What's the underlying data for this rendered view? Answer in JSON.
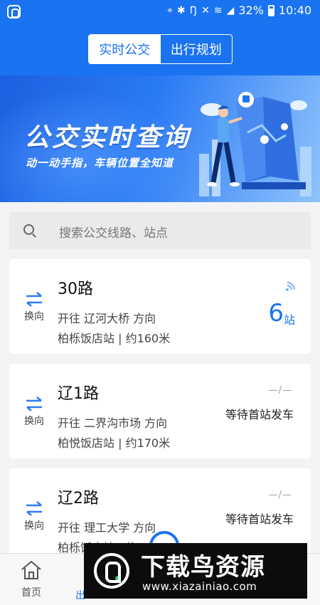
{
  "status_bar": {
    "battery": "32%",
    "time": "10:40",
    "icons": [
      "location-icon",
      "bluetooth-icon",
      "nfc-icon",
      "mute-icon",
      "wifi-icon",
      "signal-icon",
      "battery-icon"
    ]
  },
  "header": {
    "tabs": [
      {
        "label": "实时公交",
        "active": true
      },
      {
        "label": "出行规划",
        "active": false
      }
    ]
  },
  "banner": {
    "title": "公交实时查询",
    "subtitle": "动一动手指，车辆位置全知道"
  },
  "search": {
    "placeholder": "搜索公交线路、站点"
  },
  "routes": [
    {
      "name": "30路",
      "direction": "开往 辽河大桥 方向",
      "stop": "柏栎饭店站 | 约160米",
      "swap_label": "换向",
      "eta_value": "6",
      "eta_unit": "站"
    },
    {
      "name": "辽1路",
      "direction": "开往 二界沟市场 方向",
      "stop": "柏悦饭店站 | 约170米",
      "swap_label": "换向",
      "dash": "—/—",
      "status": "等待首站发车"
    },
    {
      "name": "辽2路",
      "direction": "开往 理工大学 方向",
      "stop": "柏栎饭店站 | 约",
      "swap_label": "换向",
      "dash": "—/—",
      "status": "等待首站发车"
    }
  ],
  "bottom_nav": {
    "home_label": "首页",
    "partial_label": "出"
  },
  "watermark": {
    "title": "下载鸟资源",
    "url": "www.xiazainiao.com"
  },
  "colors": {
    "primary": "#1a73f0",
    "background": "#f2f3f5"
  }
}
